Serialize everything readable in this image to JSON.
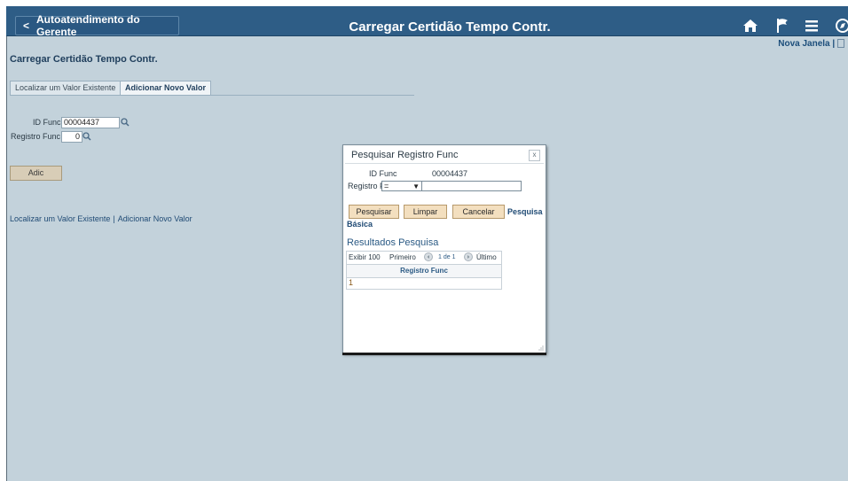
{
  "header": {
    "back_label": "Autoatendimento do Gerente",
    "title": "Carregar Certidão Tempo Contr.",
    "icons": [
      "home-icon",
      "flag-icon",
      "menu-icon",
      "navbar-icon"
    ],
    "nova_janela": "Nova Janela",
    "nova_sep": "|"
  },
  "page": {
    "title": "Carregar Certidão Tempo Contr.",
    "tabs": [
      "Localizar um Valor Existente",
      "Adicionar Novo Valor"
    ],
    "id_func_label": "ID Func",
    "id_func_value": "00004437",
    "registro_label": "Registro Func",
    "registro_value": "0",
    "add_button": "Adic",
    "links": [
      "Localizar um Valor Existente",
      "Adicionar Novo Valor"
    ],
    "link_sep": "|"
  },
  "modal": {
    "title": "Pesquisar Registro Func",
    "close": "x",
    "id_func_label": "ID Func",
    "id_func_value": "00004437",
    "registro_label": "Registro Func",
    "operator": "=",
    "buttons": [
      "Pesquisar",
      "Limpar",
      "Cancelar"
    ],
    "basic_search_1": "Pesquisa",
    "basic_search_2": "Básica",
    "results_title": "Resultados Pesquisa",
    "nav": {
      "show": "Exibir 100",
      "first": "Primeiro",
      "range": "1 de 1",
      "last": "Último"
    },
    "column": "Registro Func",
    "rows": [
      "1"
    ]
  },
  "colors": {
    "topbar": "#2e5d86",
    "background": "#c3d2db",
    "button": "#f3dfbf",
    "link": "#1f4a74"
  }
}
